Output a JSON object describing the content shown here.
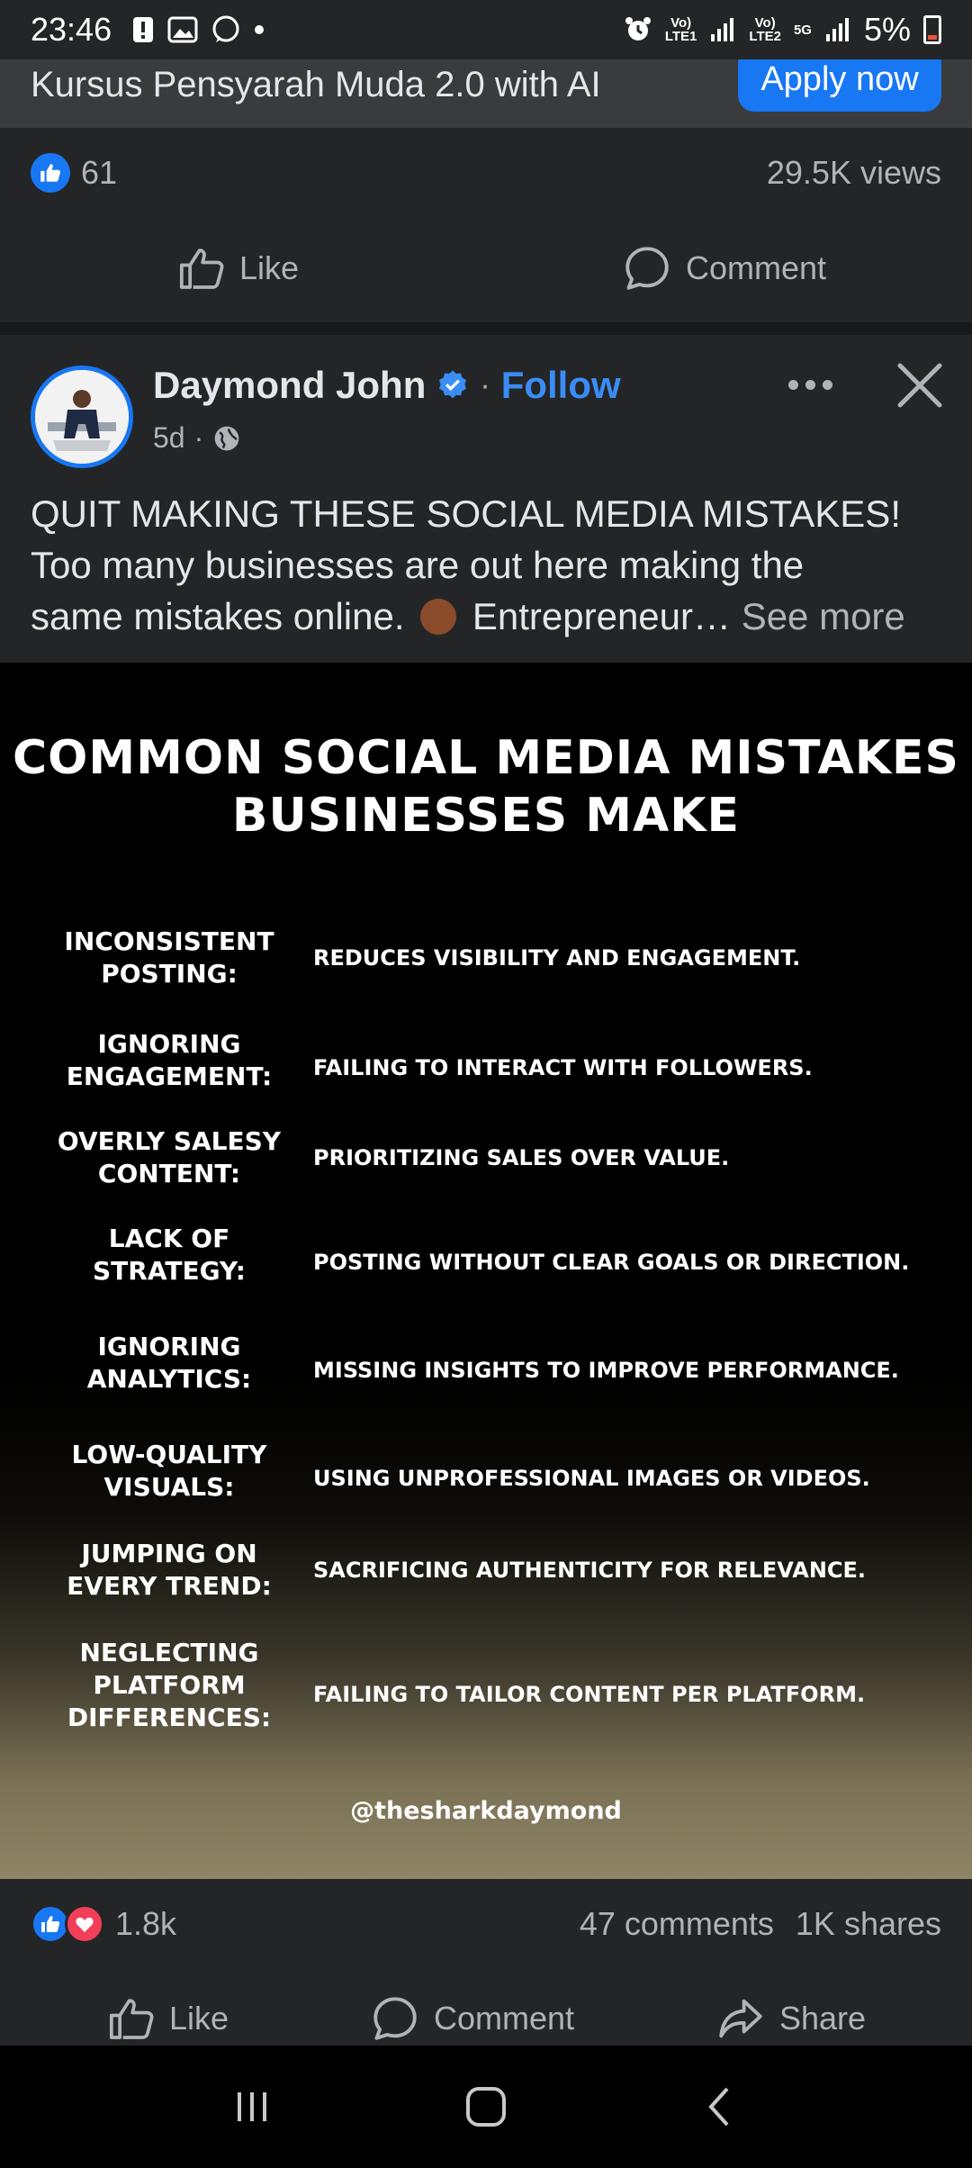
{
  "status_bar": {
    "time": "23:46",
    "net1": "Vo)\nLTE1",
    "net2": "Vo)\nLTE2",
    "net5g": "5G",
    "battery": "5%"
  },
  "prev_post": {
    "title": "Kursus Pensyarah Muda 2.0 with AI",
    "apply_label": "Apply now",
    "like_count": "61",
    "views": "29.5K views",
    "like_label": "Like",
    "comment_label": "Comment"
  },
  "post": {
    "author": "Daymond John",
    "follow_label": "Follow",
    "time": "5d",
    "text_line1": "QUIT MAKING THESE SOCIAL MEDIA MISTAKES!",
    "text_line2": "Too many businesses are out here making the",
    "text_line3a": "same mistakes online.",
    "text_line3b": "Entrepreneur…",
    "see_more": "See more"
  },
  "graphic": {
    "title_line1": "COMMON SOCIAL MEDIA MISTAKES",
    "title_line2": "BUSINESSES MAKE",
    "rows": [
      {
        "label": "INCONSISTENT\nPOSTING:",
        "desc": "REDUCES VISIBILITY AND ENGAGEMENT."
      },
      {
        "label": "IGNORING\nENGAGEMENT:",
        "desc": "FAILING TO INTERACT WITH FOLLOWERS."
      },
      {
        "label": "OVERLY SALESY\nCONTENT:",
        "desc": "PRIORITIZING SALES OVER VALUE."
      },
      {
        "label": "LACK OF\nSTRATEGY:",
        "desc": "POSTING WITHOUT CLEAR GOALS OR DIRECTION."
      },
      {
        "label": "IGNORING\nANALYTICS:",
        "desc": "MISSING INSIGHTS TO IMPROVE PERFORMANCE."
      },
      {
        "label": "LOW-QUALITY\nVISUALS:",
        "desc": "USING UNPROFESSIONAL IMAGES OR VIDEOS."
      },
      {
        "label": "JUMPING ON\nEVERY TREND:",
        "desc": "SACRIFICING AUTHENTICITY FOR RELEVANCE."
      },
      {
        "label": "NEGLECTING\nPLATFORM\nDIFFERENCES:",
        "desc": "FAILING TO TAILOR CONTENT PER PLATFORM."
      }
    ],
    "handle": "@thesharkdaymond"
  },
  "stats": {
    "reactions": "1.8k",
    "comments": "47 comments",
    "shares": "1K shares"
  },
  "actions": {
    "like": "Like",
    "comment": "Comment",
    "share": "Share"
  },
  "colors": {
    "accent": "#1877f2",
    "follow": "#3a8df5",
    "love": "#f33e58",
    "background": "#242527"
  }
}
